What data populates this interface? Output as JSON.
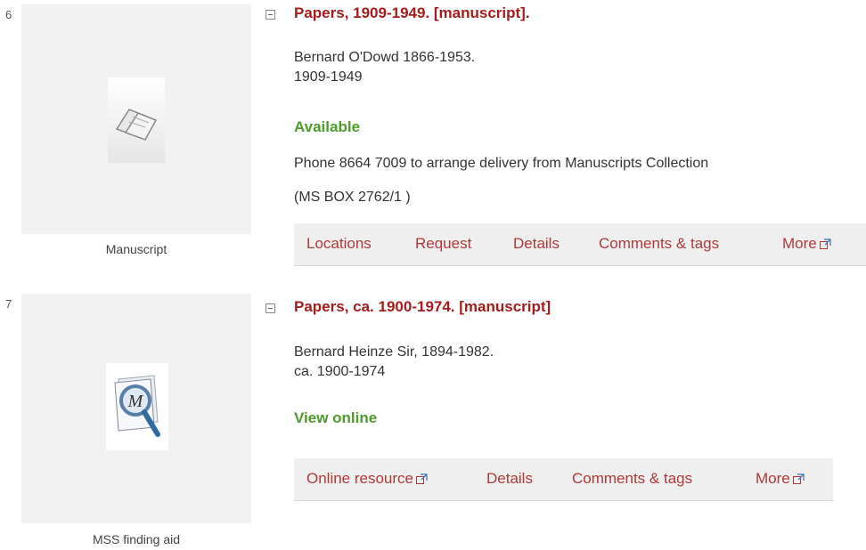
{
  "records": [
    {
      "number": "6",
      "thumbnail_icon": "book-icon",
      "thumbnail_caption": "Manuscript",
      "title": "Papers, 1909-1949. [manuscript].",
      "author": "Bernard O'Dowd 1866-1953.",
      "dates": "1909-1949",
      "status": "Available",
      "status_color": "#4e9a2b",
      "delivery_note": "Phone 8664 7009 to arrange delivery from Manuscripts Collection",
      "call_number": "(MS BOX 2762/1 )",
      "actions": [
        "Locations",
        "Request",
        "Details",
        "Comments & tags",
        "More"
      ]
    },
    {
      "number": "7",
      "thumbnail_icon": "finding-aid-icon",
      "thumbnail_caption": "MSS finding aid",
      "title": "Papers, ca. 1900-1974. [manuscript]",
      "author": "Bernard Heinze Sir, 1894-1982.",
      "dates": "ca. 1900-1974",
      "status": "View online",
      "status_color": "#4e9a2b",
      "actions": [
        "Online resource",
        "Details",
        "Comments & tags",
        "More"
      ]
    }
  ],
  "colors": {
    "title": "#a31d1d",
    "action_link": "#b03a3a",
    "action_bar_bg": "#efefef",
    "thumb_bg": "#f2f2f2"
  }
}
